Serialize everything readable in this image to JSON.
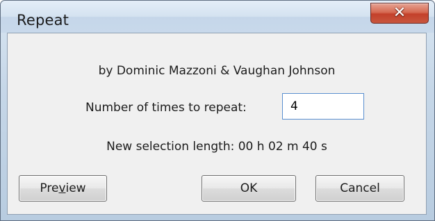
{
  "window": {
    "title": "Repeat",
    "close_icon": "close-x-icon"
  },
  "dialog": {
    "author": "by Dominic Mazzoni & Vaughan Johnson",
    "repeat_label": "Number of times to repeat:",
    "repeat_value": "4",
    "new_length": "New selection length: 00 h 02 m 40 s"
  },
  "buttons": {
    "preview_pre": "Pre",
    "preview_mnemonic": "v",
    "preview_post": "iew",
    "ok": "OK",
    "cancel": "Cancel"
  },
  "colors": {
    "close_button": "#c8573f",
    "input_focus_border": "#5a8fd0"
  }
}
